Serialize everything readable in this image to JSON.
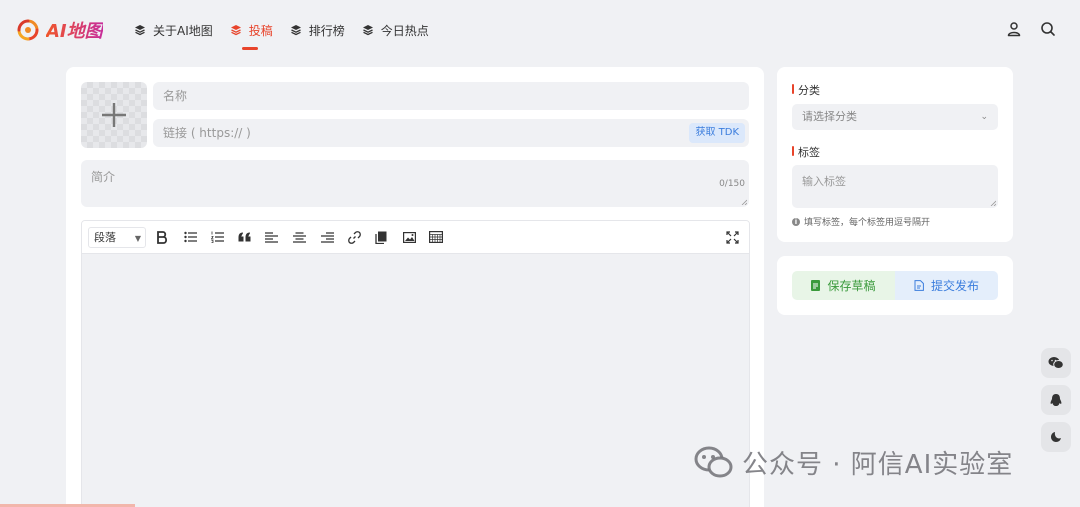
{
  "brand": {
    "name": "AI地图"
  },
  "nav": {
    "items": [
      {
        "label": "关于AI地图"
      },
      {
        "label": "投稿"
      },
      {
        "label": "排行榜"
      },
      {
        "label": "今日热点"
      }
    ],
    "active_index": 1
  },
  "form": {
    "name_placeholder": "名称",
    "url_placeholder": "链接 ( https:// )",
    "tdk_button": "获取 TDK",
    "intro_placeholder": "简介",
    "intro_counter": "0/150"
  },
  "editor": {
    "format_select": "段落",
    "toolbar": [
      "bold",
      "bullet-list",
      "numbered-list",
      "quote",
      "align-left",
      "align-center",
      "align-right",
      "link",
      "copy",
      "image",
      "table",
      "fullscreen"
    ]
  },
  "side": {
    "category_label": "分类",
    "category_placeholder": "请选择分类",
    "tags_label": "标签",
    "tags_placeholder": "输入标签",
    "tags_hint": "填写标签，每个标签用逗号隔开",
    "save_draft": "保存草稿",
    "submit_publish": "提交发布"
  },
  "floating": [
    "wechat-icon",
    "qq-icon",
    "moon-icon"
  ],
  "watermark": {
    "text": "公众号 · 阿信AI实验室"
  },
  "colors": {
    "accent": "#e8442b",
    "draft": "#3a9a3c",
    "submit": "#3b7ddd",
    "page_bg": "#f0f1f4"
  }
}
